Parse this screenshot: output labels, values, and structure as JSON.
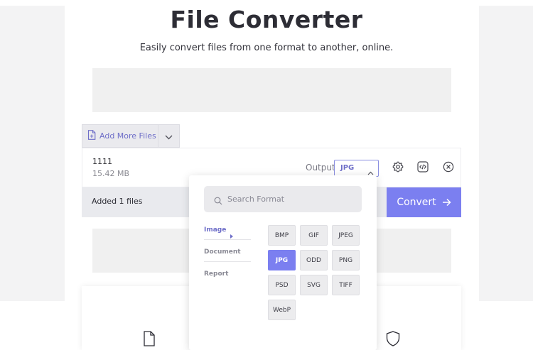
{
  "header": {
    "title": "File Converter",
    "subtitle": "Easily convert files from one format to another, online."
  },
  "upload": {
    "add_more_label": "Add More Files"
  },
  "file": {
    "name": "1111",
    "size": "15.42 MB",
    "output_label": "Output:",
    "output_value": "JPG"
  },
  "status": {
    "added_text": "Added 1 files",
    "convert_label": "Convert"
  },
  "format_popup": {
    "search_placeholder": "Search Format",
    "categories": [
      {
        "label": "Image",
        "active": true
      },
      {
        "label": "Document",
        "active": false
      },
      {
        "label": "Report",
        "active": false
      }
    ],
    "formats": [
      {
        "label": "BMP",
        "active": false
      },
      {
        "label": "GIF",
        "active": false
      },
      {
        "label": "JPEG",
        "active": false
      },
      {
        "label": "JPG",
        "active": true
      },
      {
        "label": "ODD",
        "active": false
      },
      {
        "label": "PNG",
        "active": false
      },
      {
        "label": "PSD",
        "active": false
      },
      {
        "label": "SVG",
        "active": false
      },
      {
        "label": "TIFF",
        "active": false
      },
      {
        "label": "WebP",
        "active": false
      }
    ]
  },
  "icons": {
    "add_file": "file-plus-icon",
    "dropdown": "chevron-down-icon",
    "output_chevron": "chevron-up-icon",
    "settings": "gear-icon",
    "embed": "code-icon",
    "remove": "close-circle-icon",
    "convert_arrow": "arrow-right-icon",
    "search": "search-icon",
    "category_arrow": "caret-right-icon",
    "feature_file": "file-icon",
    "feature_shield": "shield-icon"
  },
  "colors": {
    "accent": "#7b7ff0",
    "accent_text": "#6e6ec8",
    "title": "#2d2d35"
  }
}
